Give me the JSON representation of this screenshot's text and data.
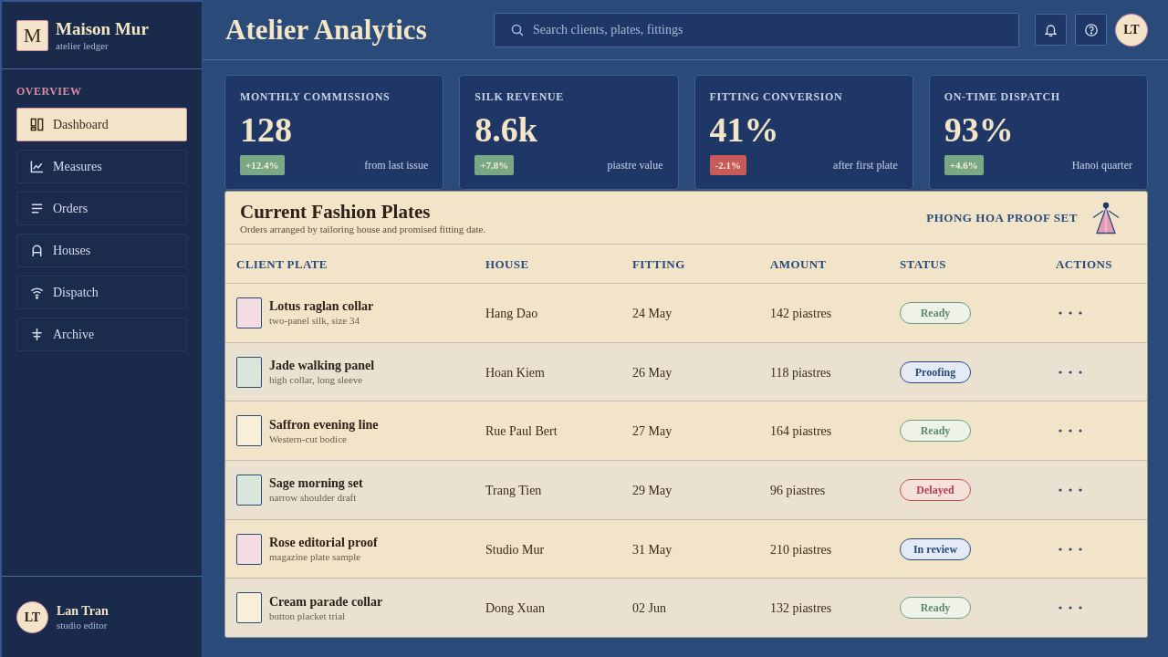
{
  "sidebar": {
    "brand": {
      "logo": "M",
      "name": "Maison Mur",
      "tagline": "atelier ledger"
    },
    "section_label": "OVERVIEW",
    "items": [
      {
        "label": "Dashboard",
        "selected": true
      },
      {
        "label": "Measures",
        "selected": false
      },
      {
        "label": "Orders",
        "selected": false
      },
      {
        "label": "Houses",
        "selected": false
      },
      {
        "label": "Dispatch",
        "selected": false
      },
      {
        "label": "Archive",
        "selected": false
      }
    ],
    "user": {
      "initials": "LT",
      "name": "Lan Tran",
      "role": "studio editor"
    }
  },
  "header": {
    "title": "Atelier Analytics",
    "search": {
      "placeholder": "Search clients, plates, fittings"
    },
    "avatar": "LT"
  },
  "stats": [
    {
      "label": "MONTHLY COMMISSIONS",
      "value": "128",
      "change": "+12.4%",
      "negative": false,
      "note": "from last issue"
    },
    {
      "label": "SILK REVENUE",
      "value": "8.6k",
      "change": "+7.8%",
      "negative": false,
      "note": "piastre value"
    },
    {
      "label": "FITTING CONVERSION",
      "value": "41%",
      "change": "-2.1%",
      "negative": true,
      "note": "after first plate"
    },
    {
      "label": "ON-TIME DISPATCH",
      "value": "93%",
      "change": "+4.6%",
      "negative": false,
      "note": "Hanoi quarter"
    }
  ],
  "table": {
    "title": "Current Fashion Plates",
    "subtitle": "Orders arranged by tailoring house and promised fitting date.",
    "proof_set": "PHONG HOA PROOF SET",
    "columns": [
      "CLIENT PLATE",
      "HOUSE",
      "FITTING",
      "AMOUNT",
      "STATUS",
      "ACTIONS"
    ],
    "rows": [
      {
        "plate": "Lotus raglan collar",
        "detail": "two-panel silk, size 34",
        "color": "#f3dde3",
        "house": "Hang Dao",
        "fitting": "24 May",
        "amount": "142 piastres",
        "status": {
          "label": "Ready",
          "kind": "ready"
        }
      },
      {
        "plate": "Jade walking panel",
        "detail": "high collar, long sleeve",
        "color": "#d8e6dc",
        "house": "Hoan Kiem",
        "fitting": "26 May",
        "amount": "118 piastres",
        "status": {
          "label": "Proofing",
          "kind": "pending"
        }
      },
      {
        "plate": "Saffron evening line",
        "detail": "Western-cut bodice",
        "color": "#f8efd8",
        "house": "Rue Paul Bert",
        "fitting": "27 May",
        "amount": "164 piastres",
        "status": {
          "label": "Ready",
          "kind": "ready"
        }
      },
      {
        "plate": "Sage morning set",
        "detail": "narrow shoulder draft",
        "color": "#d8e6dc",
        "house": "Trang Tien",
        "fitting": "29 May",
        "amount": "96 piastres",
        "status": {
          "label": "Delayed",
          "kind": "delayed"
        }
      },
      {
        "plate": "Rose editorial proof",
        "detail": "magazine plate sample",
        "color": "#f3dde3",
        "house": "Studio Mur",
        "fitting": "31 May",
        "amount": "210 piastres",
        "status": {
          "label": "In review",
          "kind": "pending"
        }
      },
      {
        "plate": "Cream parade collar",
        "detail": "button placket trial",
        "color": "#f8efd8",
        "house": "Dong Xuan",
        "fitting": "02 Jun",
        "amount": "132 piastres",
        "status": {
          "label": "Ready",
          "kind": "ready"
        }
      }
    ]
  }
}
